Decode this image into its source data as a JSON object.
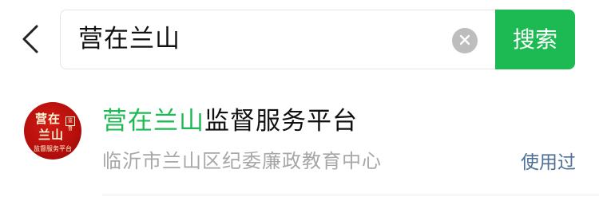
{
  "header": {
    "back_icon": "chevron-left-icon",
    "search": {
      "query": "营在兰山",
      "clear_icon": "clear-icon",
      "button_label": "搜索"
    }
  },
  "results": [
    {
      "title_highlight": "营在兰山",
      "title_rest": "监督服务平台",
      "subtitle": "临沂市兰山区纪委廉政教育中心",
      "status": "使用过",
      "logo": {
        "line1": "营在",
        "line2": "兰山",
        "tag": "监督",
        "bottom": "监督服务平台"
      }
    }
  ],
  "colors": {
    "accent": "#1dba54",
    "used_tag": "#4f6f96",
    "subtitle": "#a7a7a7",
    "logo_red": "#c2120f"
  }
}
